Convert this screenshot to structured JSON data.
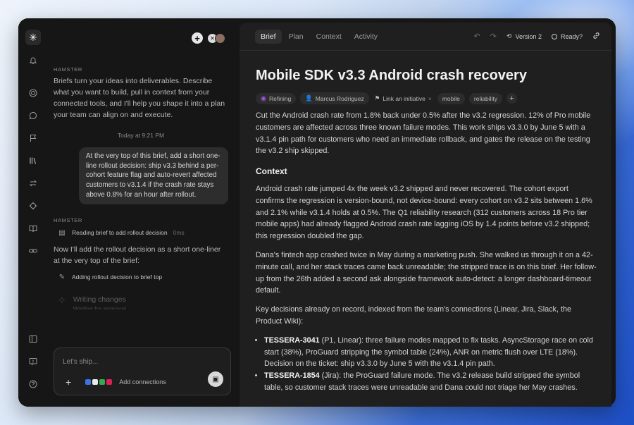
{
  "sidebar_rail": {
    "logo": "✳",
    "icons": [
      "bell-icon",
      "target-icon",
      "chat-icon",
      "flag-icon",
      "library-icon",
      "sync-icon",
      "crosshair-icon",
      "book-icon",
      "link-icon"
    ],
    "bottom_icons": [
      "panel-icon",
      "feedback-icon",
      "help-icon"
    ]
  },
  "chat": {
    "intro_sender": "HAMSTER",
    "intro_message": "Briefs turn your ideas into deliverables. Describe what you want to build, pull in context from your connected tools, and I'll help you shape it into a plan your team can align on and execute.",
    "timestamp": "Today at 9:21 PM",
    "user_message": "At the very top of this brief, add a short one-line rollout decision: ship v3.3 behind a per-cohort feature flag and auto-revert affected customers to v3.1.4 if the crash rate stays above 0.8% for an hour after rollout.",
    "reply_sender": "HAMSTER",
    "step1_label": "Reading brief to add rollout decision",
    "step1_duration": "0ms",
    "reply_message": "Now I'll add the rollout decision as a short one-liner at the very top of the brief:",
    "step2_label": "Adding rollout decision to brief top",
    "writing_title": "Writing changes",
    "writing_sub": "Waiting for approval"
  },
  "composer": {
    "placeholder": "Let's ship...",
    "add_connections": "Add connections"
  },
  "brief": {
    "tabs": [
      "Brief",
      "Plan",
      "Context",
      "Activity"
    ],
    "version": "Version 2",
    "ready": "Ready?",
    "title": "Mobile SDK v3.3 Android crash recovery",
    "chips": {
      "status": "Refining",
      "owner": "Marcus Rodriguez",
      "initiative": "Link an initiative",
      "tag1": "mobile",
      "tag2": "reliability"
    },
    "summary": "Cut the Android crash rate from 1.8% back under 0.5% after the v3.2 regression. 12% of Pro mobile customers are affected across three known failure modes. This work ships v3.3.0 by June 5 with a v3.1.4 pin path for customers who need an immediate rollback, and gates the release on the testing the v3.2 ship skipped.",
    "context_heading": "Context",
    "context_p1": "Android crash rate jumped 4x the week v3.2 shipped and never recovered. The cohort export confirms the regression is version-bound, not device-bound: every cohort on v3.2 sits between 1.6% and 2.1% while v3.1.4 holds at 0.5%. The Q1 reliability research (312 customers across 18 Pro tier mobile apps) had already flagged Android crash rate lagging iOS by 1.4 points before v3.2 shipped; this regression doubled the gap.",
    "context_p2": "Dana's fintech app crashed twice in May during a marketing push. She walked us through it on a 42-minute call, and her stack traces came back unreadable; the stripped trace is on this brief. Her follow-up from the 26th added a second ask alongside framework auto-detect: a longer dashboard-timeout default.",
    "context_p3": "Key decisions already on record, indexed from the team's connections (Linear, Jira, Slack, the Product Wiki):",
    "bullets": [
      {
        "key": "TESSERA-3041",
        "text": " (P1, Linear): three failure modes mapped to fix tasks. AsyncStorage race on cold start (38%), ProGuard stripping the symbol table (24%), ANR on metric flush over LTE (18%). Decision on the ticket: ship v3.3.0 by June 5 with the v3.1.4 pin path."
      },
      {
        "key": "TESSERA-1854",
        "text": " (Jira): the ProGuard failure mode. The v3.2 release build stripped the symbol table, so customer stack traces were unreadable and Dana could not triage her May crashes."
      }
    ]
  }
}
